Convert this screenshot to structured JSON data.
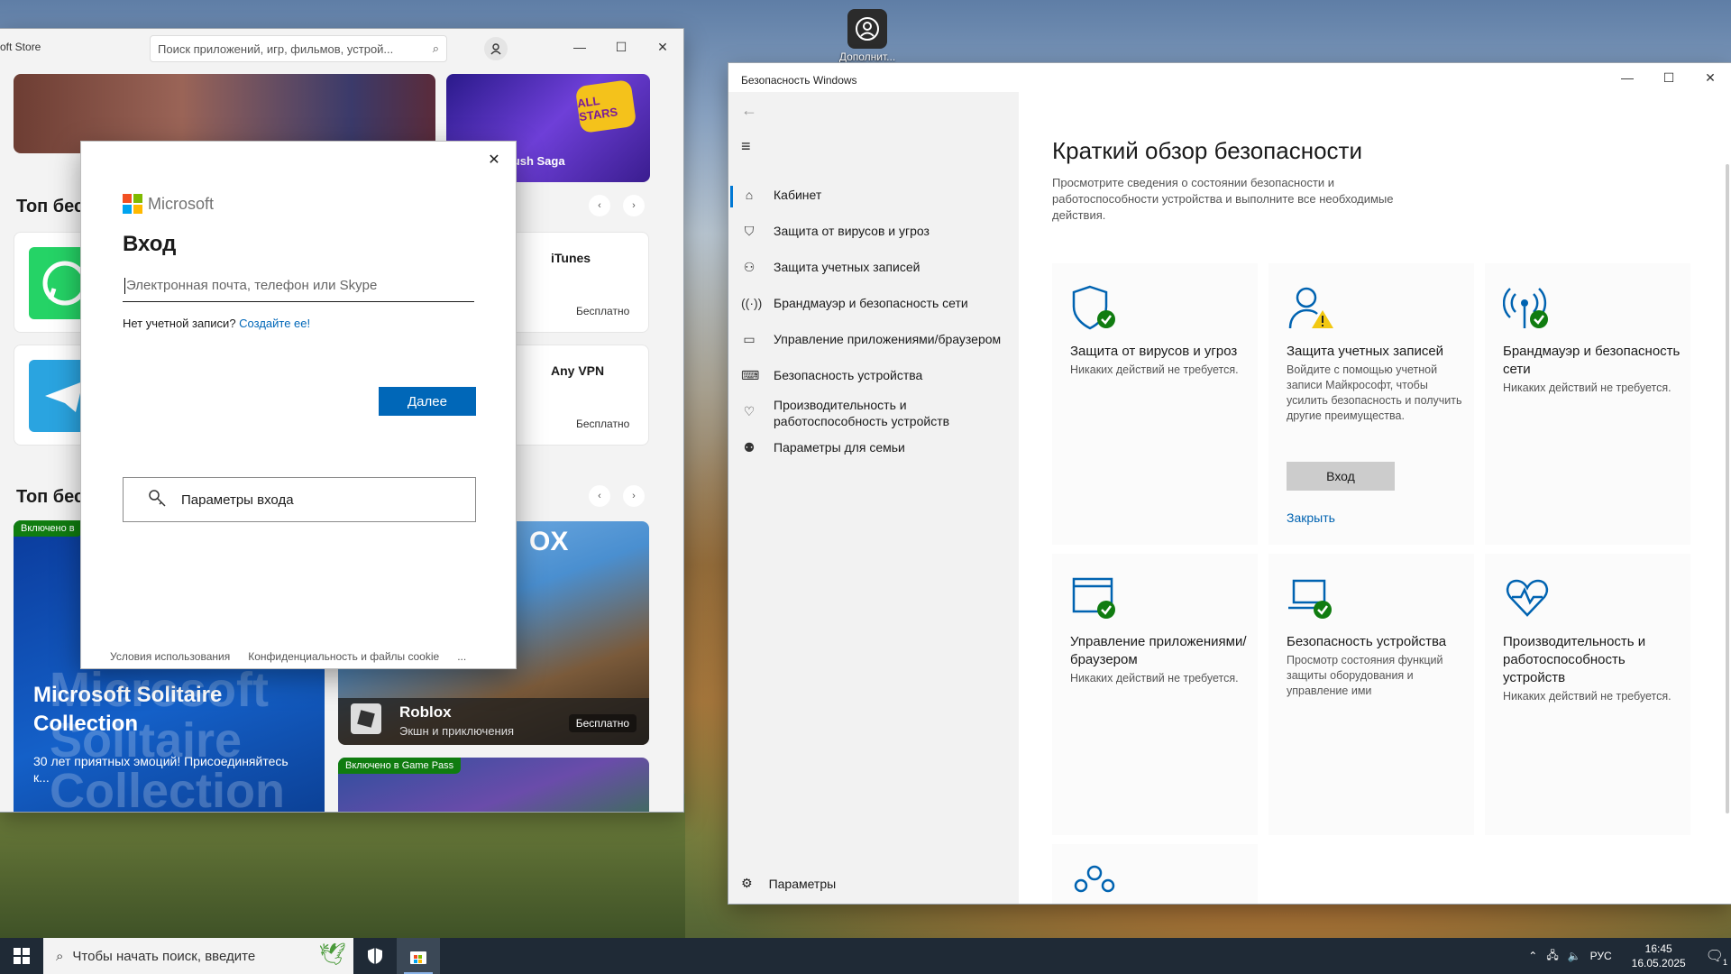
{
  "desktop": {
    "icon_label": "Дополнит..."
  },
  "store": {
    "title": "oft Store",
    "search_placeholder": "Поиск приложений, игр, фильмов, устрой...",
    "hero_candy": "Candy Crush Saga",
    "hero_candy_badge": "ALL STARS",
    "section1": "Топ бес",
    "section2": "Топ бес",
    "apps": [
      {
        "name": "iTunes",
        "price": "Бесплатно"
      },
      {
        "name": "Any VPN",
        "price": "Бесплатно"
      }
    ],
    "gamepass_badge": "Включено в",
    "gamepass_badge_full": "Включено в Game Pass",
    "solitaire_title": "Microsoft Solitaire Collection",
    "solitaire_watermark": "Microsoft Solitaire Collection",
    "solitaire_sub": "30 лет приятных эмоций! Присоединяйтесь к...",
    "roblox_name": "Roblox",
    "roblox_genre": "Экшн и приключения",
    "roblox_price": "Бесплатно",
    "roblox_ox": "OX"
  },
  "login": {
    "brand": "Microsoft",
    "heading": "Вход",
    "input_placeholder": "Электронная почта, телефон или Skype",
    "no_account": "Нет учетной записи?",
    "create_link": "Создайте ее!",
    "next_button": "Далее",
    "sign_in_options": "Параметры входа",
    "footer_terms": "Условия использования",
    "footer_privacy": "Конфиденциальность и файлы cookie",
    "footer_more": "..."
  },
  "security": {
    "window_title": "Безопасность Windows",
    "nav": [
      {
        "label": "Кабинет"
      },
      {
        "label": "Защита от вирусов и угроз"
      },
      {
        "label": "Защита учетных записей"
      },
      {
        "label": "Брандмауэр и безопасность сети"
      },
      {
        "label": "Управление приложениями/браузером"
      },
      {
        "label": "Безопасность устройства"
      },
      {
        "label": "Производительность и работоспособность устройств"
      },
      {
        "label": "Параметры для семьи"
      }
    ],
    "settings_label": "Параметры",
    "heading": "Краткий обзор безопасности",
    "description": "Просмотрите сведения о состоянии безопасности и работоспособности устройства и выполните все необходимые действия.",
    "tiles": [
      {
        "title": "Защита от вирусов и угроз",
        "desc": "Никаких действий не требуется."
      },
      {
        "title": "Защита учетных записей",
        "desc": "Войдите с помощью учетной записи Майкрософт, чтобы усилить безопасность и получить другие преимущества.",
        "button": "Вход",
        "link": "Закрыть"
      },
      {
        "title": "Брандмауэр и безопасность сети",
        "desc": "Никаких действий не требуется."
      },
      {
        "title": "Управление приложениями/браузером",
        "desc": "Никаких действий не требуется."
      },
      {
        "title": "Безопасность устройства",
        "desc": "Просмотр состояния функций защиты оборудования и управление ими"
      },
      {
        "title": "Производительность и работоспособность устройств",
        "desc": "Никаких действий не требуется."
      }
    ]
  },
  "taskbar": {
    "search_placeholder": "Чтобы начать поиск, введите",
    "lang": "РУС",
    "time": "16:45",
    "date": "16.05.2025",
    "notif_count": "1"
  },
  "colors": {
    "accent": "#0078d4",
    "ok": "#107c10",
    "warn": "#f2c811",
    "login_blue": "#0067b8"
  }
}
